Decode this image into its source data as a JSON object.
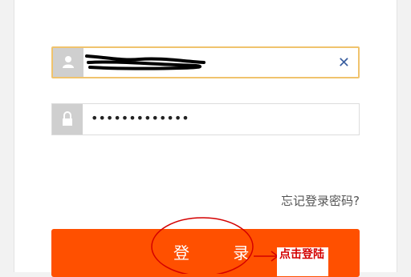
{
  "username": {
    "value": "",
    "clear_icon": "✕",
    "icon": "user-icon",
    "border_color": "#f0c36d"
  },
  "password": {
    "value": "•••••••••••••",
    "icon": "lock-icon"
  },
  "forgot_password": "忘记登录密码?",
  "login_button": {
    "label": "登 录",
    "color": "#ff5000"
  },
  "annotation": {
    "text": "点击登陆",
    "color": "#d40000"
  }
}
